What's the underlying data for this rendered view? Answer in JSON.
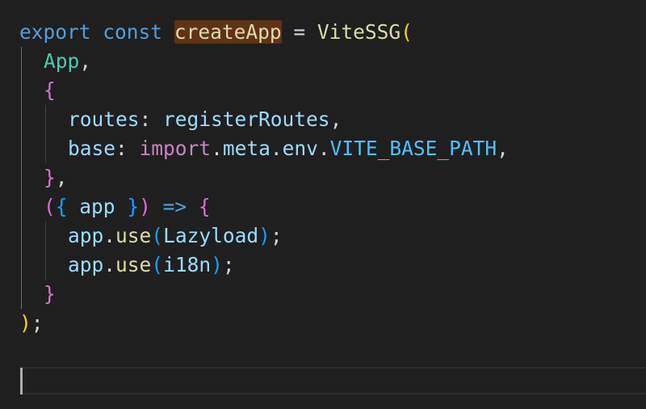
{
  "editor": {
    "line1": {
      "kw_export": "export",
      "kw_const": "const",
      "name": "createApp",
      "eq": "=",
      "fn": "ViteSSG",
      "paren_open": "("
    },
    "line2": {
      "arg": "App",
      "comma": ","
    },
    "line3": {
      "brace_open": "{"
    },
    "line4": {
      "key": "routes",
      "colon": ":",
      "value": "registerRoutes",
      "comma": ","
    },
    "line5": {
      "key": "base",
      "colon": ":",
      "import": "import",
      "dot1": ".",
      "meta": "meta",
      "dot2": ".",
      "env": "env",
      "dot3": ".",
      "const": "VITE_BASE_PATH",
      "comma": ","
    },
    "line6": {
      "brace_close": "}",
      "comma": ","
    },
    "line7": {
      "paren_open": "(",
      "brace_open": "{",
      "param": "app",
      "brace_close": "}",
      "paren_close": ")",
      "arrow": "=>",
      "body_open": "{"
    },
    "line8": {
      "obj": "app",
      "dot": ".",
      "method": "use",
      "p_open": "(",
      "arg": "Lazyload",
      "p_close": ")",
      "semi": ";"
    },
    "line9": {
      "obj": "app",
      "dot": ".",
      "method": "use",
      "p_open": "(",
      "arg": "i18n",
      "p_close": ")",
      "semi": ";"
    },
    "line10": {
      "body_close": "}"
    },
    "line11": {
      "paren_close": ")",
      "semi": ";"
    }
  }
}
